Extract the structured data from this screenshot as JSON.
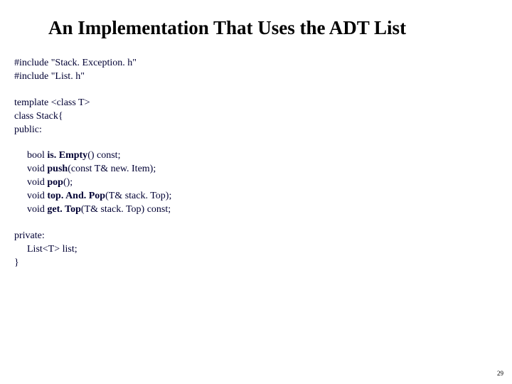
{
  "title": "An Implementation That Uses the ADT List",
  "includes": {
    "line1": "#include \"Stack. Exception. h\"",
    "line2": "#include \"List. h\""
  },
  "classdecl": {
    "template": "template <class T>",
    "classline": "class Stack{",
    "public": "public:"
  },
  "methods": {
    "m1_pre": "bool ",
    "m1_name": "is. Empty",
    "m1_post": "() const;",
    "m2_pre": "void ",
    "m2_name": "push",
    "m2_post": "(const T& new. Item);",
    "m3_pre": "void ",
    "m3_name": "pop",
    "m3_post": "();",
    "m4_pre": "void ",
    "m4_name": "top. And. Pop",
    "m4_post": "(T& stack. Top);",
    "m5_pre": "void ",
    "m5_name": "get. Top",
    "m5_post": "(T& stack. Top) const;"
  },
  "private": {
    "label": "private:",
    "member": "List<T> list;",
    "close": "}"
  },
  "pagenum": "29"
}
